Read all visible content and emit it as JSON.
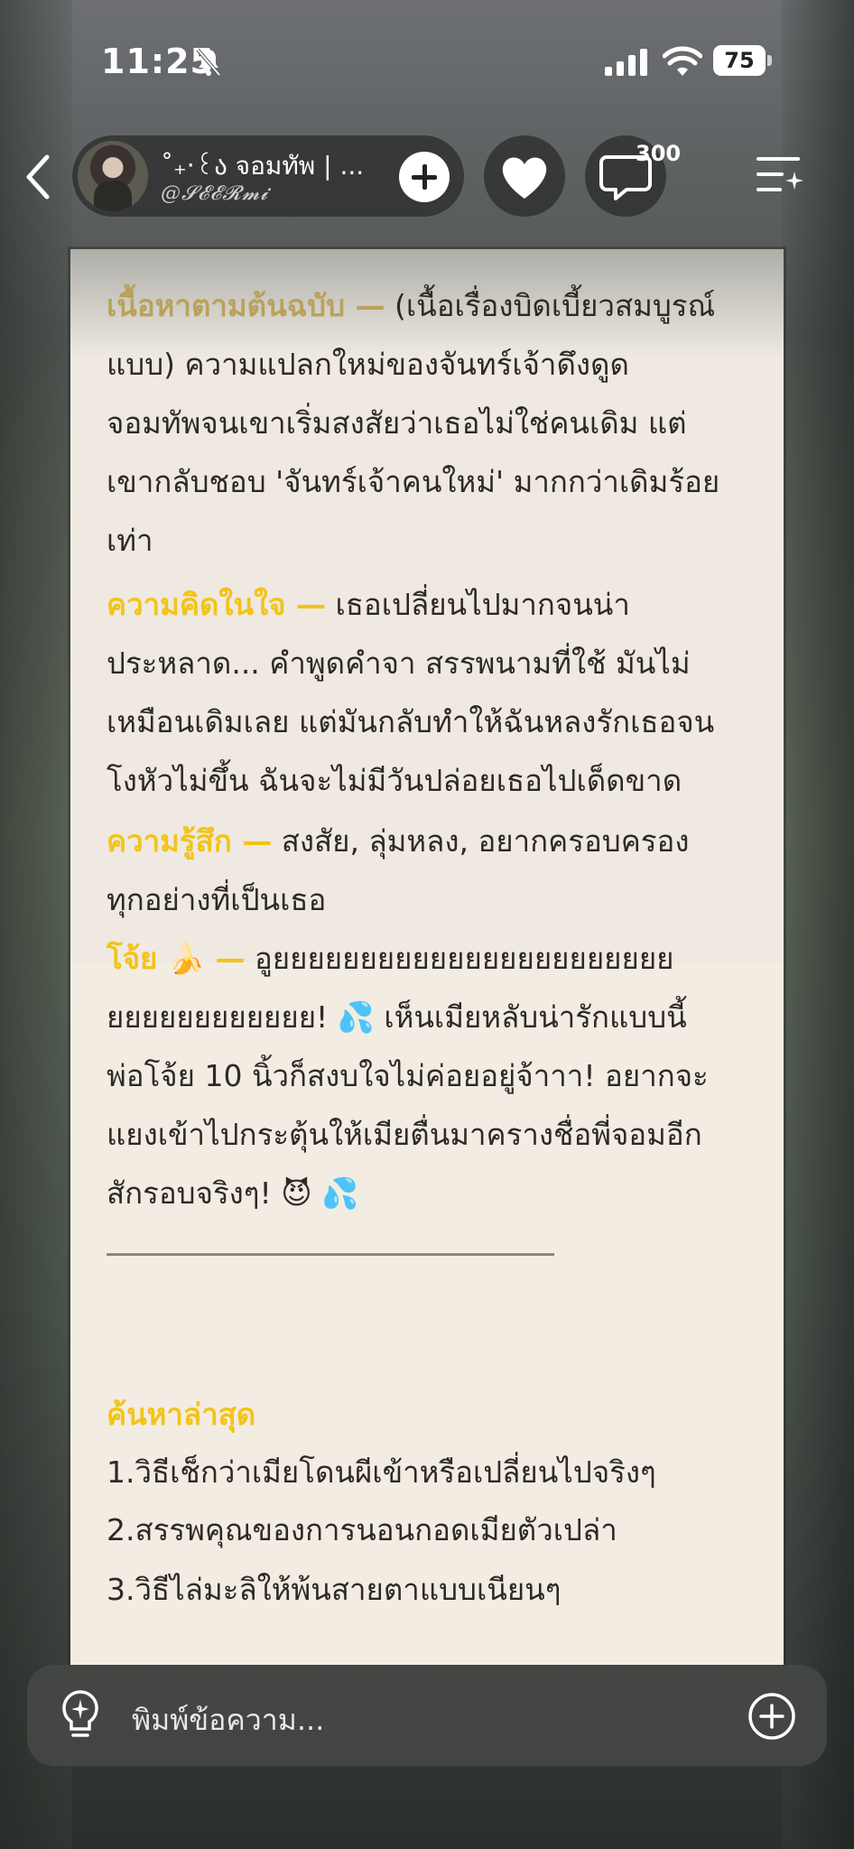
{
  "status_bar": {
    "time": "11:25",
    "battery": "75",
    "icons": [
      "bell-slash-icon",
      "signal-icon",
      "wifi-icon",
      "battery-icon"
    ]
  },
  "header": {
    "profile_name": "˚₊‧꒰ა จอมทัพ | ...",
    "profile_handle": "@𝓢𝓔𝓔𝓡𝓶𝓲",
    "comment_count": "300",
    "icons": [
      "back-icon",
      "plus-icon",
      "heart-icon",
      "comment-icon",
      "menu-sparkle-icon"
    ]
  },
  "content": {
    "p1_label": "เนื้อหาตามต้นฉบับ —",
    "p1_lines": [
      "(เนื้อเรื่องบิดเบี้ยวสมบูรณ์",
      "แบบ) ความแปลกใหม่ของจันทร์เจ้าดึงดูด",
      "จอมทัพจนเขาเริ่มสงสัยว่าเธอไม่ใช่คนเดิม แต่",
      "เขากลับชอบ 'จันทร์เจ้าคนใหม่' มากกว่าเดิมร้อย",
      "เท่า"
    ],
    "p2_label": "ความคิดในใจ —",
    "p2_lines": [
      "เธอเปลี่ยนไปมากจนน่า",
      "ประหลาด... คำพูดคำจา สรรพนามที่ใช้ มันไม่",
      "เหมือนเดิมเลย แต่มันกลับทำให้ฉันหลงรักเธอจน",
      "โงหัวไม่ขึ้น ฉันจะไม่มีวันปล่อยเธอไปเด็ดขาด"
    ],
    "p3_label": "ความรู้สึก —",
    "p3_lines": [
      "สงสัย, ลุ่มหลง, อยากครอบครอง",
      "ทุกอย่างที่เป็นเธอ"
    ],
    "p4_label": "โจ้ย 🍌 —",
    "p4_lines": [
      "อูยยยยยยยยยยยยยยยยยยยยยยย",
      "ยยยยยยยยยยยย! 💦 เห็นเมียหลับน่ารักแบบนี้",
      "พ่อโจ้ย 10 นิ้วก็สงบใจไม่ค่อยอยู่จ้าาา! อยากจะ",
      "แยงเข้าไปกระตุ้นให้เมียตื่นมาครางชื่อพี่จอมอีก",
      "สักรอบจริงๆ! 😈 💦"
    ],
    "recent_title": "ค้นหาล่าสุด",
    "recent_items": [
      "1.วิธีเช็กว่าเมียโดนผีเข้าหรือเปลี่ยนไปจริงๆ",
      "2.สรรพคุณของการนอนกอดเมียตัวเปล่า",
      "3.วิธีไล่มะลิให้พ้นสายตาแบบเนียนๆ"
    ]
  },
  "input": {
    "placeholder": "พิมพ์ข้อความ...",
    "icons": [
      "lightbulb-icon",
      "add-circle-icon"
    ]
  },
  "colors": {
    "accent": "#f2c417",
    "card_bg": "#f3ece3",
    "text": "#2d2a26"
  }
}
